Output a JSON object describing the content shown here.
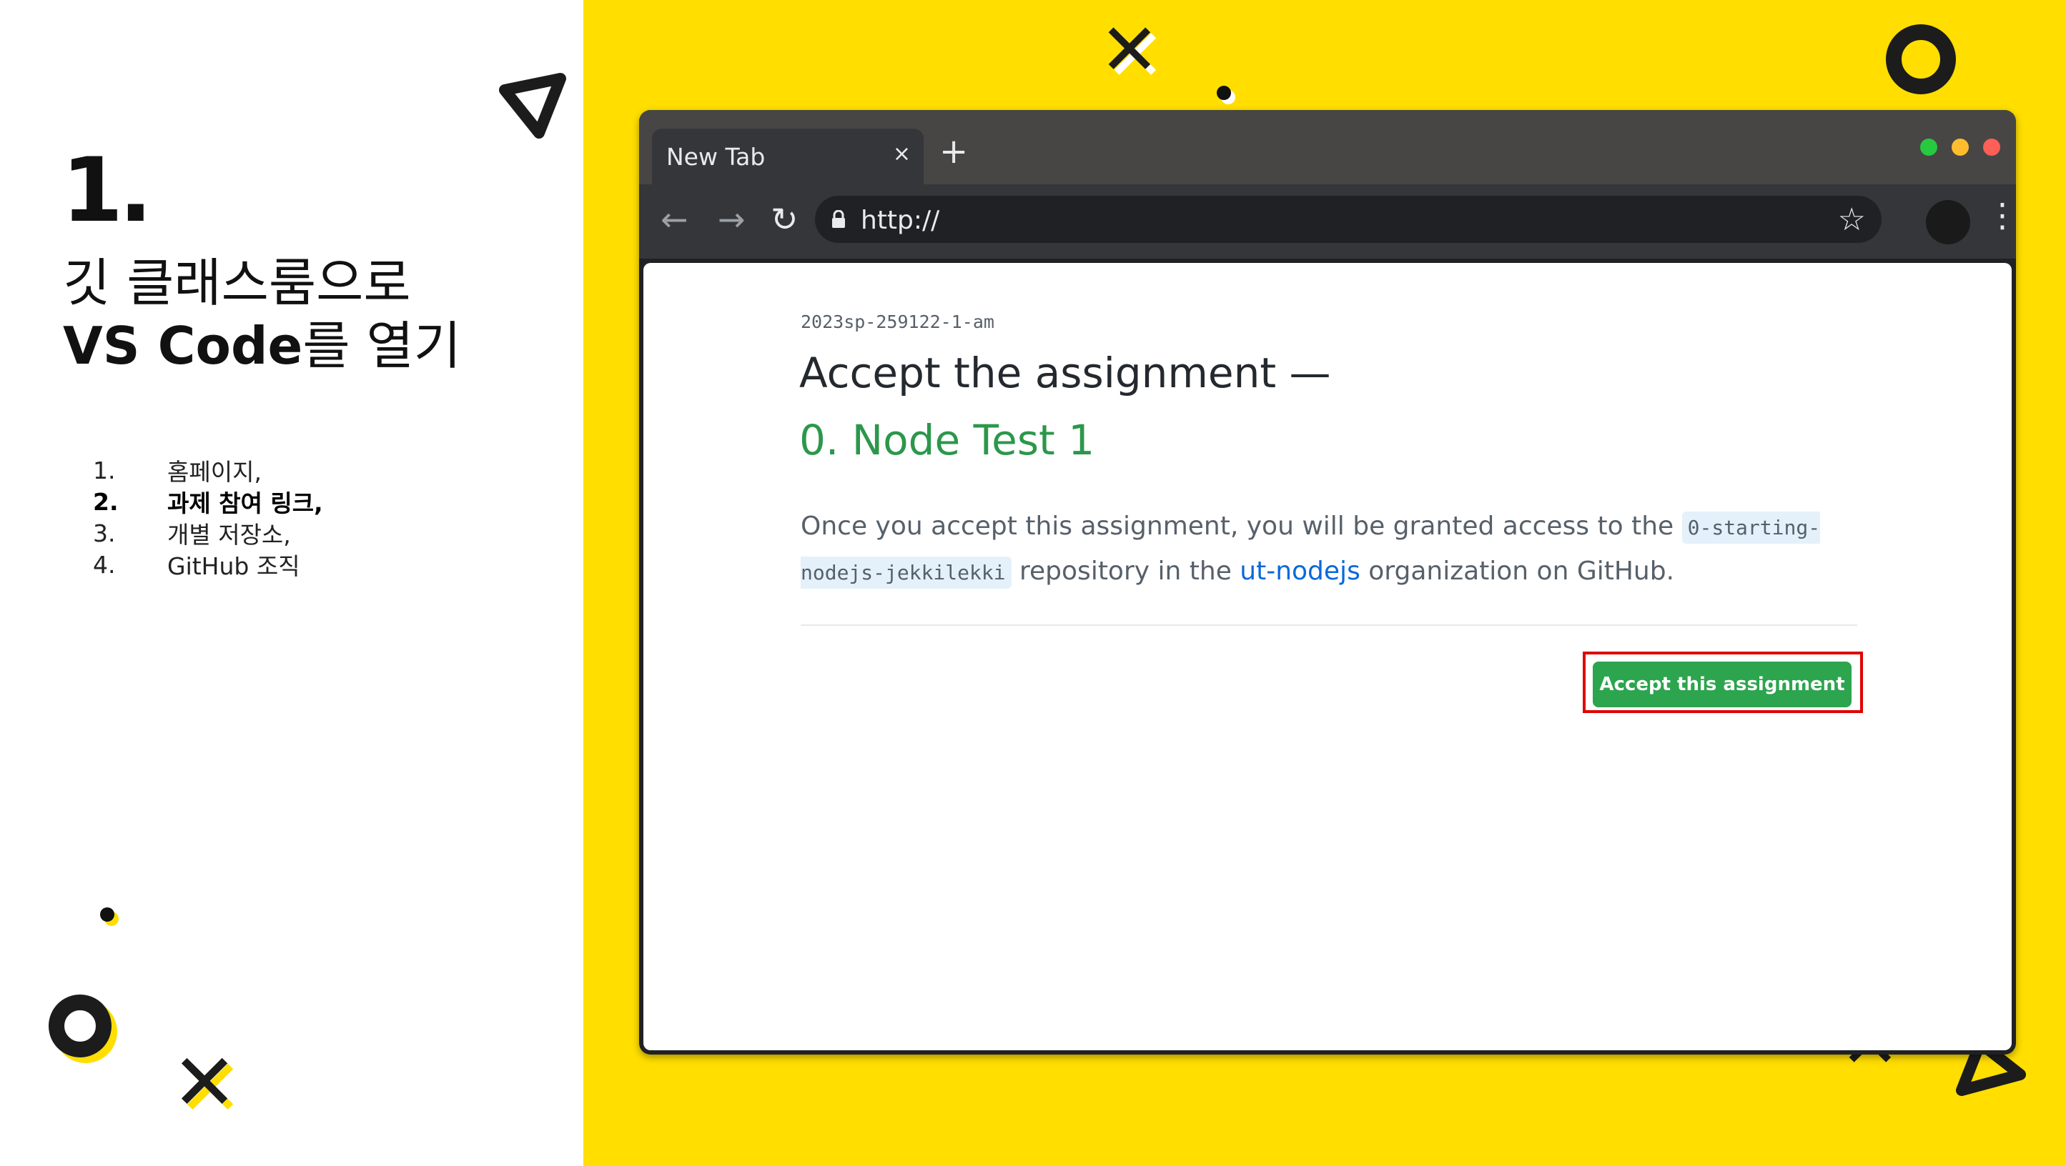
{
  "slide": {
    "step_number": "1.",
    "title_line1": "깃 클래스룸으로",
    "title_line2_bold": "VS Code",
    "title_line2_rest": "를 열기",
    "steps": [
      {
        "num": "1.",
        "text": "홈페이지,"
      },
      {
        "num": "2.",
        "text": "과제 참여 링크,"
      },
      {
        "num": "3.",
        "text": "개별 저장소,"
      },
      {
        "num": "4.",
        "text": "GitHub 조직"
      }
    ]
  },
  "browser": {
    "tab_title": "New Tab",
    "tab_close": "×",
    "new_tab": "+",
    "back": "←",
    "forward": "→",
    "reload": "↻",
    "url": "http://",
    "star": "☆",
    "kebab": "⋮"
  },
  "page": {
    "slug": "2023sp-259122-1-am",
    "heading": "Accept the assignment —",
    "assignment_name": "0. Node Test 1",
    "desc_part1": "Once you accept this assignment, you will be granted access to the ",
    "repo_name": "0-starting-nodejs-jekkilekki",
    "desc_part2": " repository in the ",
    "org_name": "ut-nodejs",
    "desc_part3": " organization on GitHub.",
    "accept_button": "Accept this assignment"
  },
  "colors": {
    "background_accent": "#FFDE00",
    "primary_green": "#2da44e",
    "highlight_red": "#e00000",
    "window_dot_green": "#27c93f",
    "window_dot_yellow": "#ffbd2e",
    "window_dot_red": "#ff5f56"
  },
  "icons": [
    "close-icon",
    "plus-icon",
    "back-arrow-icon",
    "forward-arrow-icon",
    "reload-icon",
    "lock-icon",
    "star-icon",
    "profile-avatar",
    "kebab-menu-icon"
  ]
}
